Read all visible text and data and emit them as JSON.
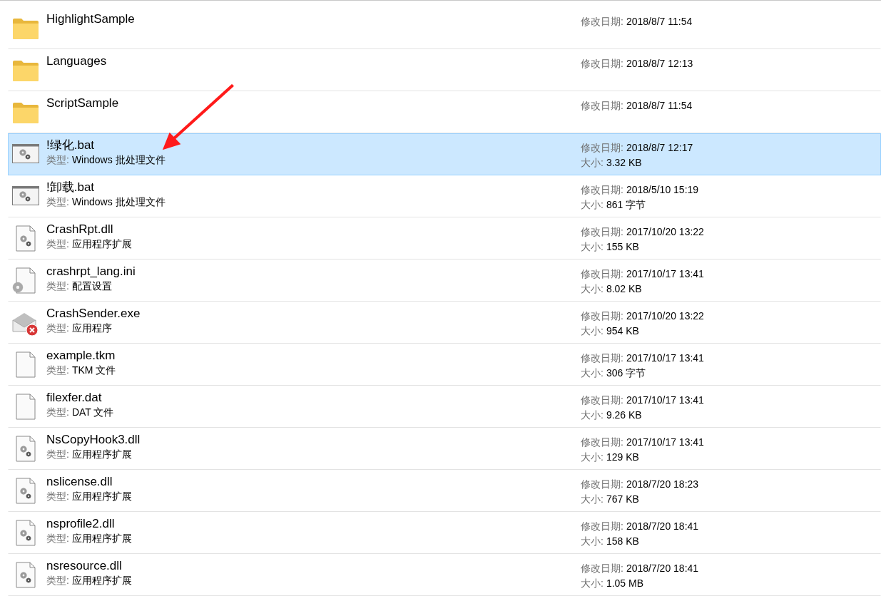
{
  "files": [
    {
      "name": "HighlightSample",
      "kind": "folder",
      "selected": false,
      "meta": [
        {
          "label": "修改日期:",
          "value": "2018/8/7 11:54"
        }
      ]
    },
    {
      "name": "Languages",
      "kind": "folder",
      "selected": false,
      "meta": [
        {
          "label": "修改日期:",
          "value": "2018/8/7 12:13"
        }
      ]
    },
    {
      "name": "ScriptSample",
      "kind": "folder",
      "selected": false,
      "meta": [
        {
          "label": "修改日期:",
          "value": "2018/8/7 11:54"
        }
      ]
    },
    {
      "name": "!绿化.bat",
      "kind": "batch",
      "selected": true,
      "details": [
        {
          "label": "类型:",
          "value": "Windows 批处理文件"
        }
      ],
      "meta": [
        {
          "label": "修改日期:",
          "value": "2018/8/7 12:17"
        },
        {
          "label": "大小:",
          "value": "3.32 KB"
        }
      ]
    },
    {
      "name": "!卸载.bat",
      "kind": "batch",
      "selected": false,
      "details": [
        {
          "label": "类型:",
          "value": "Windows 批处理文件"
        }
      ],
      "meta": [
        {
          "label": "修改日期:",
          "value": "2018/5/10 15:19"
        },
        {
          "label": "大小:",
          "value": "861 字节"
        }
      ]
    },
    {
      "name": "CrashRpt.dll",
      "kind": "library",
      "selected": false,
      "details": [
        {
          "label": "类型:",
          "value": "应用程序扩展"
        }
      ],
      "meta": [
        {
          "label": "修改日期:",
          "value": "2017/10/20 13:22"
        },
        {
          "label": "大小:",
          "value": "155 KB"
        }
      ]
    },
    {
      "name": "crashrpt_lang.ini",
      "kind": "settings",
      "selected": false,
      "details": [
        {
          "label": "类型:",
          "value": "配置设置"
        }
      ],
      "meta": [
        {
          "label": "修改日期:",
          "value": "2017/10/17 13:41"
        },
        {
          "label": "大小:",
          "value": "8.02 KB"
        }
      ]
    },
    {
      "name": "CrashSender.exe",
      "kind": "mail",
      "selected": false,
      "details": [
        {
          "label": "类型:",
          "value": "应用程序"
        }
      ],
      "meta": [
        {
          "label": "修改日期:",
          "value": "2017/10/20 13:22"
        },
        {
          "label": "大小:",
          "value": "954 KB"
        }
      ]
    },
    {
      "name": "example.tkm",
      "kind": "blank",
      "selected": false,
      "details": [
        {
          "label": "类型:",
          "value": "TKM 文件"
        }
      ],
      "meta": [
        {
          "label": "修改日期:",
          "value": "2017/10/17 13:41"
        },
        {
          "label": "大小:",
          "value": "306 字节"
        }
      ]
    },
    {
      "name": "filexfer.dat",
      "kind": "blank",
      "selected": false,
      "details": [
        {
          "label": "类型:",
          "value": "DAT 文件"
        }
      ],
      "meta": [
        {
          "label": "修改日期:",
          "value": "2017/10/17 13:41"
        },
        {
          "label": "大小:",
          "value": "9.26 KB"
        }
      ]
    },
    {
      "name": "NsCopyHook3.dll",
      "kind": "library",
      "selected": false,
      "details": [
        {
          "label": "类型:",
          "value": "应用程序扩展"
        }
      ],
      "meta": [
        {
          "label": "修改日期:",
          "value": "2017/10/17 13:41"
        },
        {
          "label": "大小:",
          "value": "129 KB"
        }
      ]
    },
    {
      "name": "nslicense.dll",
      "kind": "library",
      "selected": false,
      "details": [
        {
          "label": "类型:",
          "value": "应用程序扩展"
        }
      ],
      "meta": [
        {
          "label": "修改日期:",
          "value": "2018/7/20 18:23"
        },
        {
          "label": "大小:",
          "value": "767 KB"
        }
      ]
    },
    {
      "name": "nsprofile2.dll",
      "kind": "library",
      "selected": false,
      "details": [
        {
          "label": "类型:",
          "value": "应用程序扩展"
        }
      ],
      "meta": [
        {
          "label": "修改日期:",
          "value": "2018/7/20 18:41"
        },
        {
          "label": "大小:",
          "value": "158 KB"
        }
      ]
    },
    {
      "name": "nsresource.dll",
      "kind": "library",
      "selected": false,
      "details": [
        {
          "label": "类型:",
          "value": "应用程序扩展"
        }
      ],
      "meta": [
        {
          "label": "修改日期:",
          "value": "2018/7/20 18:41"
        },
        {
          "label": "大小:",
          "value": "1.05 MB"
        }
      ]
    }
  ]
}
